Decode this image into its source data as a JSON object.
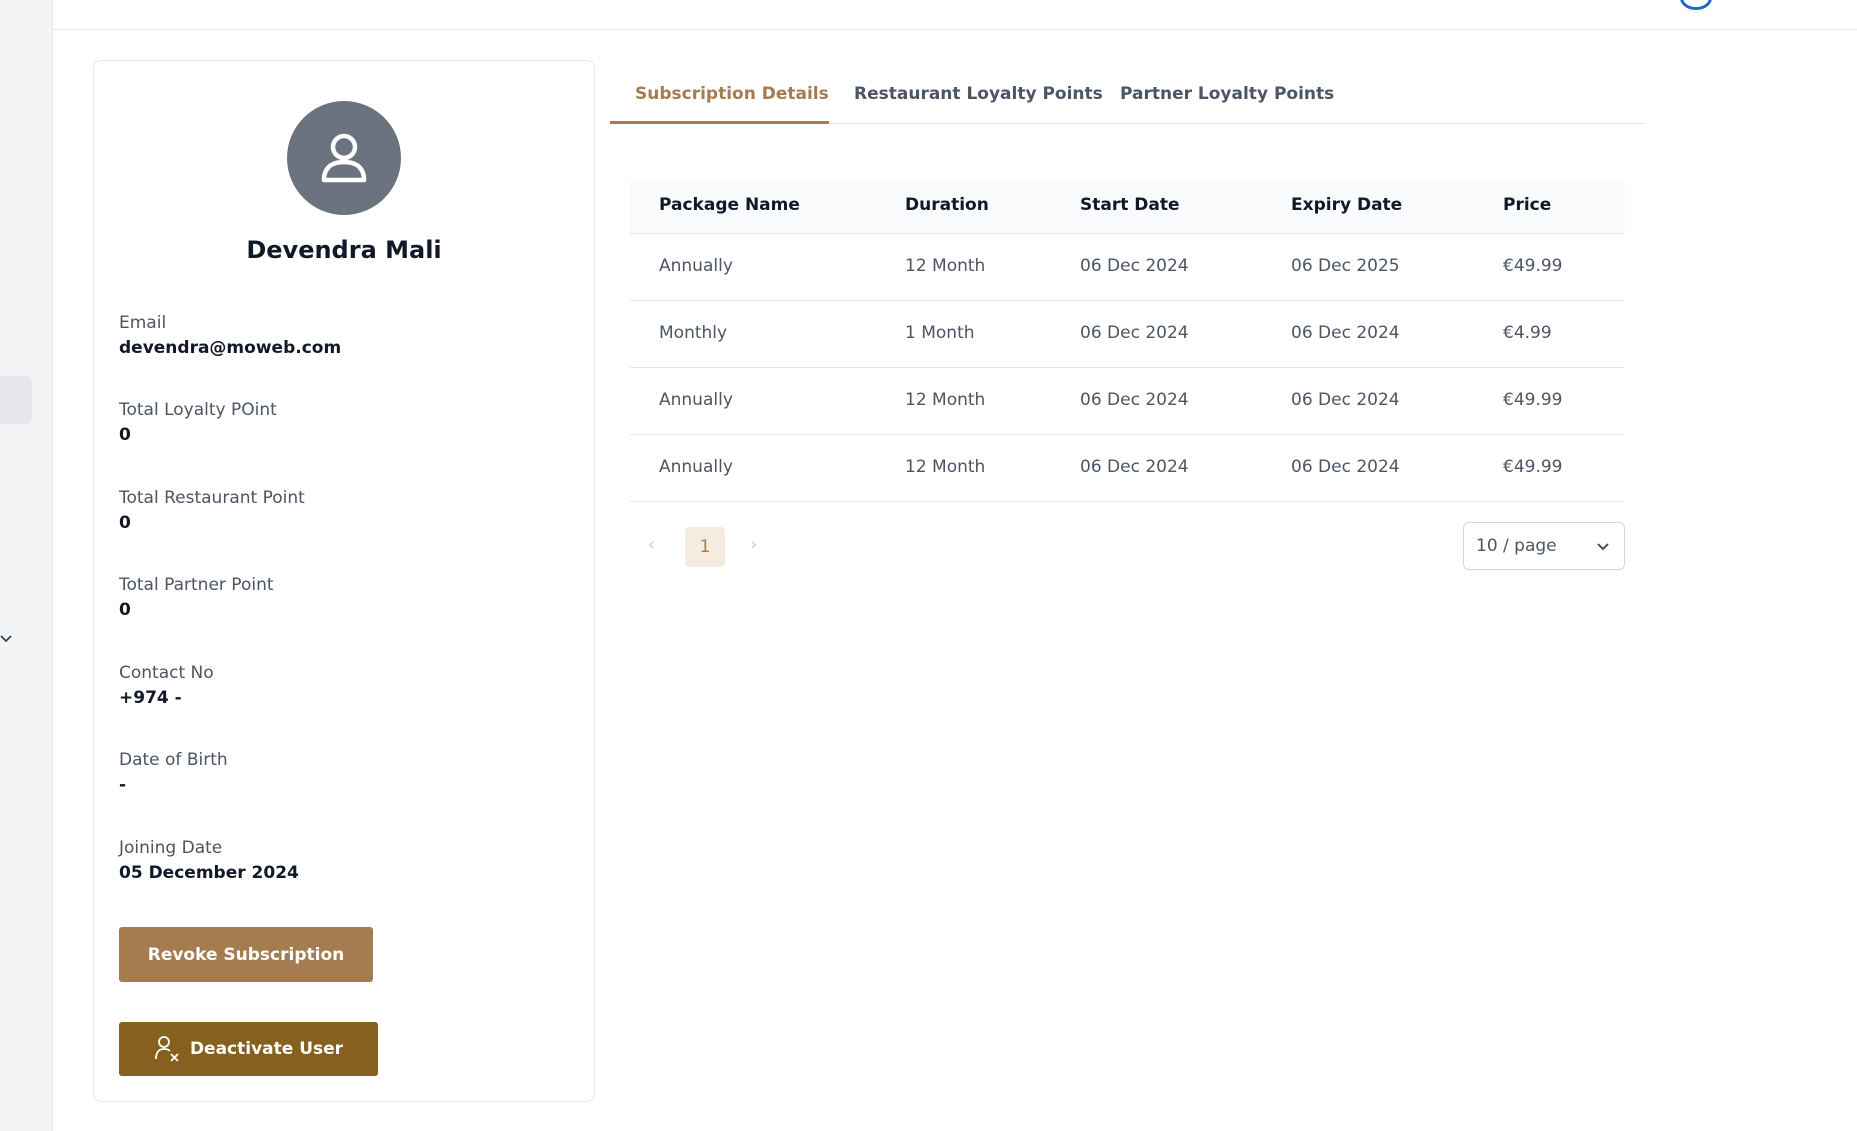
{
  "profile": {
    "name": "Devendra Mali",
    "fields": [
      {
        "label": "Email",
        "value": "devendra@moweb.com"
      },
      {
        "label": "Total Loyalty POint",
        "value": "0"
      },
      {
        "label": "Total Restaurant Point",
        "value": "0"
      },
      {
        "label": "Total Partner Point",
        "value": "0"
      },
      {
        "label": "Contact No",
        "value": "+974 -"
      },
      {
        "label": "Date of Birth",
        "value": "-"
      },
      {
        "label": "Joining Date",
        "value": "05 December 2024"
      }
    ],
    "revoke_label": "Revoke Subscription",
    "deactivate_label": "Deactivate User"
  },
  "tabs": [
    {
      "label": "Subscription Details",
      "active": true
    },
    {
      "label": "Restaurant Loyalty Points",
      "active": false
    },
    {
      "label": "Partner Loyalty Points",
      "active": false
    }
  ],
  "table": {
    "headers": [
      "Package Name",
      "Duration",
      "Start Date",
      "Expiry Date",
      "Price"
    ],
    "rows": [
      [
        "Annually",
        "12 Month",
        "06 Dec 2024",
        "06 Dec 2025",
        "€49.99"
      ],
      [
        "Monthly",
        "1 Month",
        "06 Dec 2024",
        "06 Dec 2024",
        "€4.99"
      ],
      [
        "Annually",
        "12 Month",
        "06 Dec 2024",
        "06 Dec 2024",
        "€49.99"
      ],
      [
        "Annually",
        "12 Month",
        "06 Dec 2024",
        "06 Dec 2024",
        "€49.99"
      ]
    ]
  },
  "pagination": {
    "current_page": "1",
    "page_size": "10 / page",
    "prev_icon": "chevron-left-icon",
    "next_icon": "chevron-right-icon"
  },
  "colors": {
    "accent": "#a47c4f",
    "deactivate": "#86601e",
    "avatar_bg": "#6b7280"
  }
}
